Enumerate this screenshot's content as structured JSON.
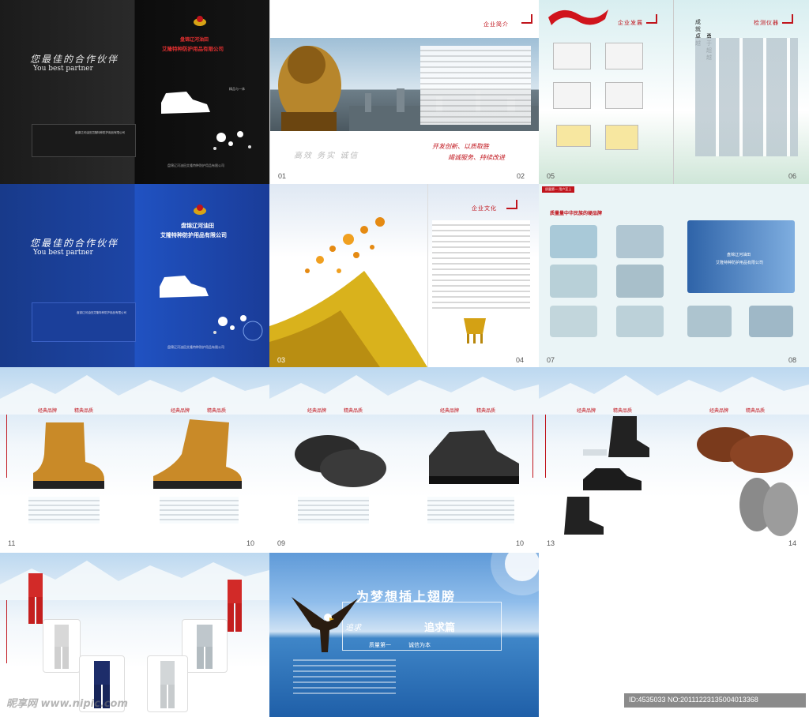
{
  "cover_black": {
    "slogan": "您最佳的合作伙伴",
    "slogan_en": "You best partner",
    "company_line1": "盘锦辽河油田",
    "company_line2": "艾隆特种防护用品有限公司",
    "box_text": "盘锦辽河油田艾隆特种防护用品有限公司",
    "footer": "盘锦辽河油田艾隆特种防护用品有限公司",
    "small_label": "精品与一体"
  },
  "cover_blue": {
    "slogan": "您最佳的合作伙伴",
    "slogan_en": "You best partner",
    "company_line1": "盘锦辽河油田",
    "company_line2": "艾隆特种防护用品有限公司",
    "box_text": "盘锦辽河油田艾隆特种防护用品有限公司",
    "footer": "盘锦辽河油田艾隆特种防护用品有限公司"
  },
  "intro": {
    "section": "企业简介",
    "motto1": "开发创新、以质取胜",
    "motto2": "竭诚服务、持续改进",
    "watermark": "高效  务实  诚信",
    "page_left": "01",
    "page_right": "02"
  },
  "honors": {
    "section1": "企业发展",
    "section2": "检测仪器",
    "vertical1": "成就卓越",
    "vertical2": "勇于超越",
    "page_left": "05",
    "page_right": "06"
  },
  "culture": {
    "section": "企业文化",
    "page_left": "03",
    "page_right": "04"
  },
  "factory": {
    "tag": "质量第一  用户至上",
    "title": "质量量中华民族的硬品牌",
    "sign1": "盘锦辽河油田",
    "sign2": "艾隆特种防护用品有限公司",
    "page_left": "07",
    "page_right": "08"
  },
  "products": {
    "heading_left": "经典品牌",
    "heading_right": "精典品质",
    "p1_left": "11",
    "p1_right": "10",
    "p2_left": "09",
    "p2_right": "10",
    "p3_left": "13",
    "p3_right": "14"
  },
  "dream": {
    "title": "为梦想插上翅膀",
    "sub": "追求篇",
    "brand": "追求",
    "tag1": "质量第一",
    "tag2": "诚信为本"
  },
  "watermark": {
    "site": "昵享网 www.nipic.com",
    "id": "ID:4535033 NO:20111223135004013368"
  }
}
